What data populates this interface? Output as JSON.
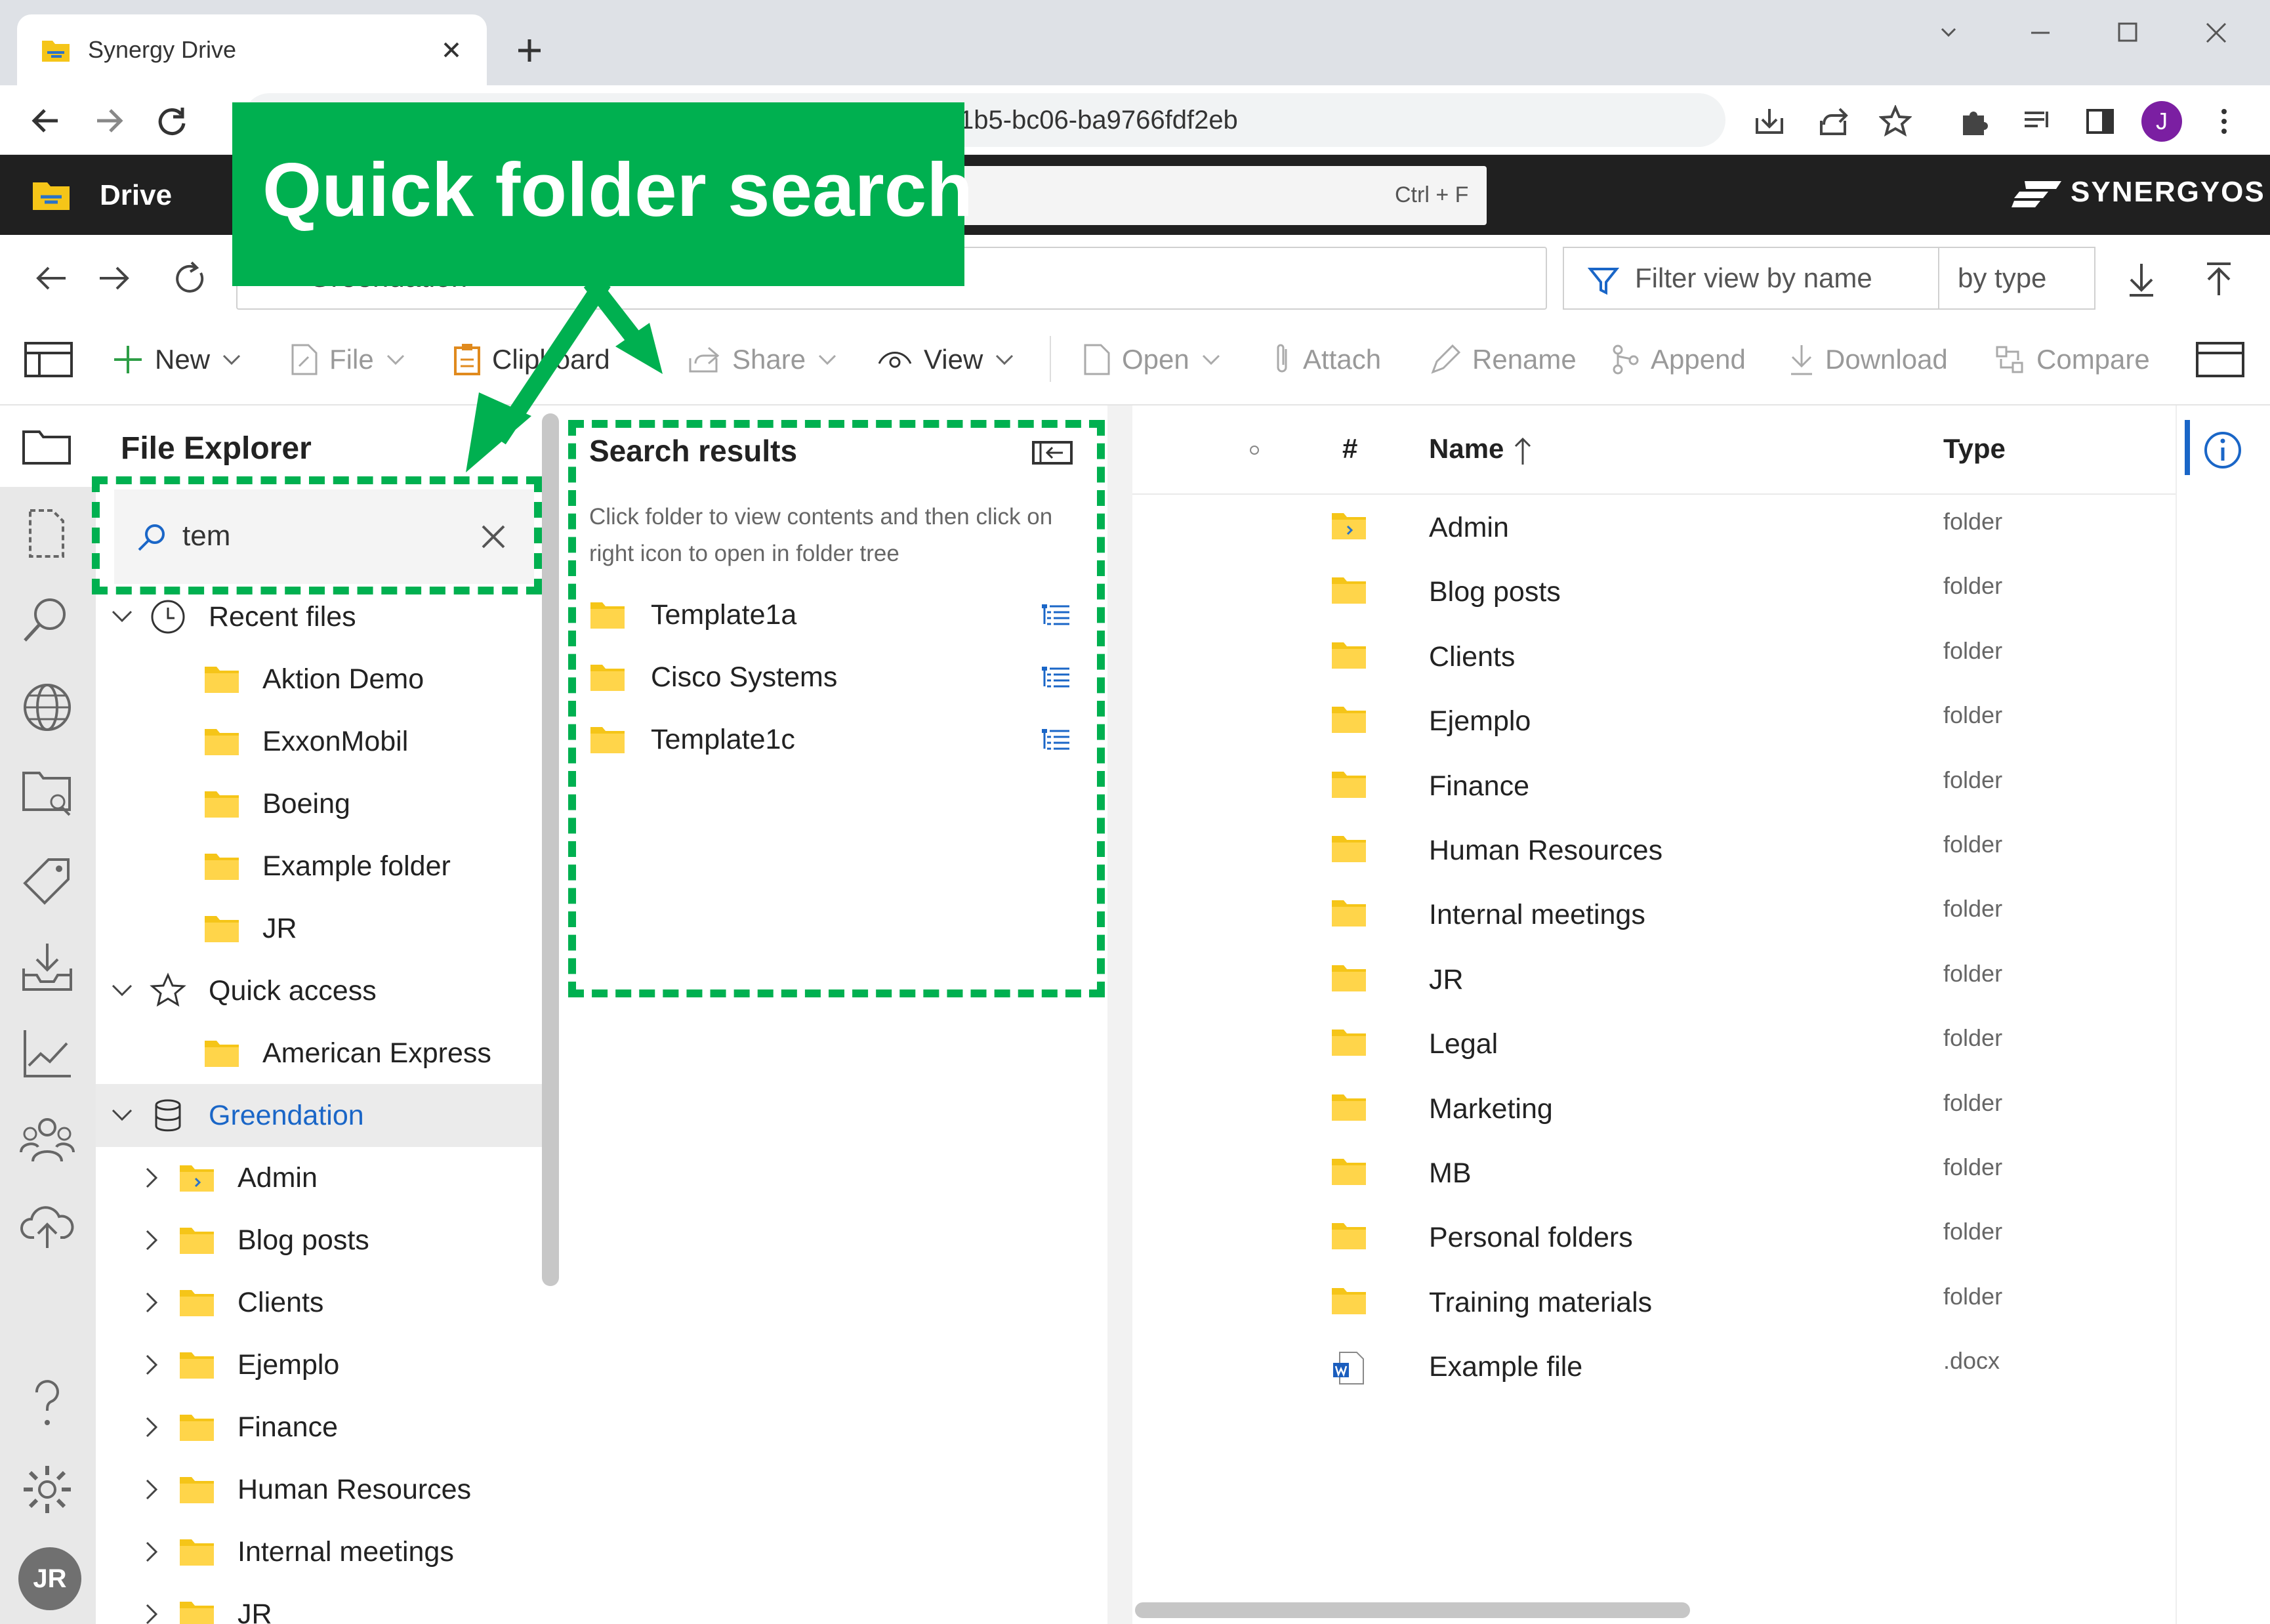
{
  "browser": {
    "tab_title": "Synergy Drive",
    "url": "1b5-bc06-ba9766fdf2eb",
    "profile_initial": "J"
  },
  "app": {
    "title": "Drive",
    "search_shortcut": "Ctrl + F",
    "brand": "SYNERGYOS",
    "path": "Greendation",
    "filter_placeholder": "Filter view by name",
    "filter_type": "by type"
  },
  "commands": {
    "new": "New",
    "file": "File",
    "clipboard": "Clipboard",
    "share": "Share",
    "view": "View",
    "open": "Open",
    "attach": "Attach",
    "rename": "Rename",
    "append": "Append",
    "download": "Download",
    "compare": "Compare"
  },
  "explorer": {
    "title": "File Explorer",
    "search_value": "tem",
    "recent_label": "Recent files",
    "recent_items": [
      "Aktion Demo",
      "ExxonMobil",
      "Boeing",
      "Example folder",
      "JR"
    ],
    "quick_label": "Quick access",
    "quick_items": [
      "American Express"
    ],
    "root_label": "Greendation",
    "root_items": [
      "Admin",
      "Blog posts",
      "Clients",
      "Ejemplo",
      "Finance",
      "Human Resources",
      "Internal meetings",
      "JR"
    ]
  },
  "search_results": {
    "title": "Search results",
    "hint": "Click folder to view contents and then click on right icon to open in folder tree",
    "items": [
      "Template1a",
      "Cisco Systems",
      "Template1c"
    ]
  },
  "file_list": {
    "col_hash": "#",
    "col_name": "Name",
    "col_type": "Type",
    "rows": [
      {
        "name": "Admin",
        "type": "folder"
      },
      {
        "name": "Blog posts",
        "type": "folder"
      },
      {
        "name": "Clients",
        "type": "folder"
      },
      {
        "name": "Ejemplo",
        "type": "folder"
      },
      {
        "name": "Finance",
        "type": "folder"
      },
      {
        "name": "Human Resources",
        "type": "folder"
      },
      {
        "name": "Internal meetings",
        "type": "folder"
      },
      {
        "name": "JR",
        "type": "folder"
      },
      {
        "name": "Legal",
        "type": "folder"
      },
      {
        "name": "Marketing",
        "type": "folder"
      },
      {
        "name": "MB",
        "type": "folder"
      },
      {
        "name": "Personal folders",
        "type": "folder"
      },
      {
        "name": "Training materials",
        "type": "folder"
      },
      {
        "name": "Example file",
        "type": ".docx"
      }
    ]
  },
  "user": {
    "initials": "JR"
  },
  "annotation": {
    "callout": "Quick folder search"
  },
  "colors": {
    "accent": "#00b050",
    "folder": "#f5c518",
    "link": "#1a66c7"
  }
}
